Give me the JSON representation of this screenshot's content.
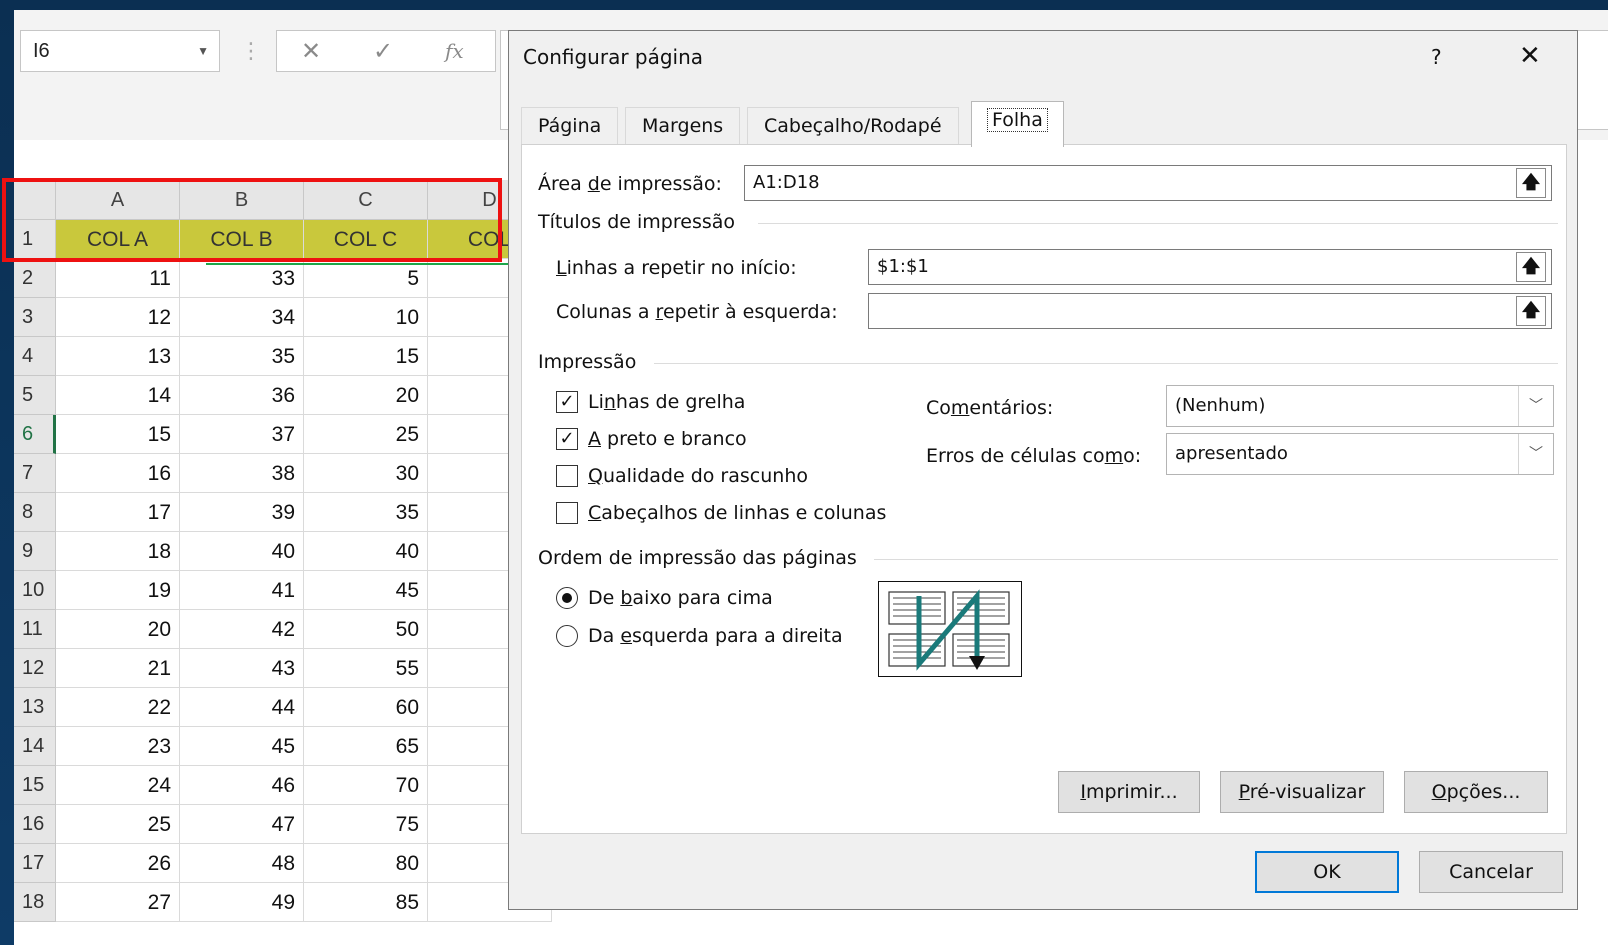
{
  "spreadsheet": {
    "name_box": "I6",
    "fx_symbol": "fx",
    "cancel_symbol": "✕",
    "enter_symbol": "✓",
    "columns": [
      "A",
      "B",
      "C",
      "D"
    ],
    "header_row": {
      "row": "1",
      "cells": [
        "COL A",
        "COL B",
        "COL C",
        "COL"
      ]
    },
    "rows": [
      {
        "n": "2",
        "a": "11",
        "b": "33",
        "c": "5"
      },
      {
        "n": "3",
        "a": "12",
        "b": "34",
        "c": "10"
      },
      {
        "n": "4",
        "a": "13",
        "b": "35",
        "c": "15"
      },
      {
        "n": "5",
        "a": "14",
        "b": "36",
        "c": "20"
      },
      {
        "n": "6",
        "a": "15",
        "b": "37",
        "c": "25"
      },
      {
        "n": "7",
        "a": "16",
        "b": "38",
        "c": "30"
      },
      {
        "n": "8",
        "a": "17",
        "b": "39",
        "c": "35"
      },
      {
        "n": "9",
        "a": "18",
        "b": "40",
        "c": "40"
      },
      {
        "n": "10",
        "a": "19",
        "b": "41",
        "c": "45"
      },
      {
        "n": "11",
        "a": "20",
        "b": "42",
        "c": "50"
      },
      {
        "n": "12",
        "a": "21",
        "b": "43",
        "c": "55"
      },
      {
        "n": "13",
        "a": "22",
        "b": "44",
        "c": "60"
      },
      {
        "n": "14",
        "a": "23",
        "b": "45",
        "c": "65"
      },
      {
        "n": "15",
        "a": "24",
        "b": "46",
        "c": "70"
      },
      {
        "n": "16",
        "a": "25",
        "b": "47",
        "c": "75"
      },
      {
        "n": "17",
        "a": "26",
        "b": "48",
        "c": "80"
      },
      {
        "n": "18",
        "a": "27",
        "b": "49",
        "c": "85"
      }
    ],
    "active_row": "6",
    "colors": {
      "header_fill": "#c9c83c",
      "highlight_box": "#ee1111",
      "arrow": "#1ea64a"
    }
  },
  "dialog": {
    "title": "Configurar página",
    "help": "?",
    "close": "✕",
    "tabs": [
      "Página",
      "Margens",
      "Cabeçalho/Rodapé",
      "Folha"
    ],
    "active_tab": "Folha",
    "print_area": {
      "label_pre": "Área ",
      "label_u": "d",
      "label_post": "e impressão:",
      "value": "A1:D18"
    },
    "print_titles": {
      "group": "Títulos de impressão",
      "rows_label_u": "L",
      "rows_label_post": "inhas a repetir no início:",
      "rows_value": "$1:$1",
      "cols_label_pre": "Colunas a ",
      "cols_label_u": "r",
      "cols_label_post": "epetir à esquerda:",
      "cols_value": ""
    },
    "collapse_icon": "🡅",
    "print": {
      "group": "Impressão",
      "gridlines": {
        "pre": "Li",
        "u": "n",
        "post": "has de grelha",
        "checked": true
      },
      "black_white": {
        "pre": "",
        "u": "A",
        "post": " preto e branco",
        "checked": true
      },
      "draft": {
        "pre": "",
        "u": "Q",
        "post": "ualidade do rascunho",
        "checked": false
      },
      "headings": {
        "pre": "",
        "u": "C",
        "post": "abeçalhos de linhas e colunas",
        "checked": false
      },
      "comments_label_pre": "Co",
      "comments_label_u": "m",
      "comments_label_post": "entários:",
      "comments_value": "(Nenhum)",
      "errors_label_pre": "Erros de células co",
      "errors_label_u": "m",
      "errors_label_post": "o:",
      "errors_value": "apresentado"
    },
    "page_order": {
      "group": "Ordem de impressão das páginas",
      "down_then_over": {
        "pre": "De ",
        "u": "b",
        "post": "aixo para cima",
        "selected": true
      },
      "over_then_down": {
        "pre": "Da ",
        "u": "e",
        "post": "squerda para a direita",
        "selected": false
      }
    },
    "buttons": {
      "print": {
        "u": "I",
        "post": "mprimir..."
      },
      "preview": {
        "u": "P",
        "post": "ré-visualizar"
      },
      "options": {
        "u": "O",
        "post": "pções..."
      },
      "ok": "OK",
      "cancel": "Cancelar"
    },
    "checkmark": "✓"
  }
}
